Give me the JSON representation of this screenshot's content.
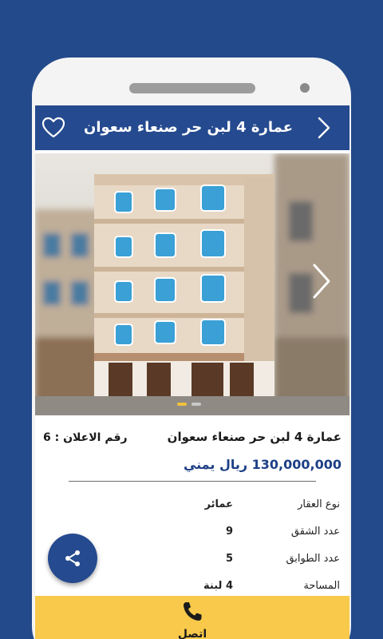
{
  "app": {
    "header_title": "عمارة 4 لبن حر صنعاء سعوان",
    "icons": {
      "favorite": "heart-outline-icon",
      "back": "chevron-right-icon",
      "next_image": "chevron-right-icon",
      "share": "share-icon",
      "call": "phone-icon"
    }
  },
  "gallery": {
    "image_count": 2,
    "active_index": 0,
    "colors": {
      "active_dot": "#f0c23a",
      "inactive_dot": "#c9c9c9"
    }
  },
  "listing": {
    "title": "عمارة 4 لبن حر صنعاء سعوان",
    "ad_number": "رقم الاعلان : 6",
    "price": "130,000,000 ريال يمني"
  },
  "specs": [
    {
      "label": "نوع العقار",
      "value": "عمائر"
    },
    {
      "label": "عدد الشقق",
      "value": "9"
    },
    {
      "label": "عدد الطوابق",
      "value": "5"
    },
    {
      "label": "المساحة",
      "value": "4 لبنة"
    }
  ],
  "call": {
    "label": "اتصل"
  },
  "colors": {
    "brand": "#254a8f",
    "background": "#234a8a",
    "call_bar": "#f8c94a",
    "price": "#1d3f86"
  }
}
